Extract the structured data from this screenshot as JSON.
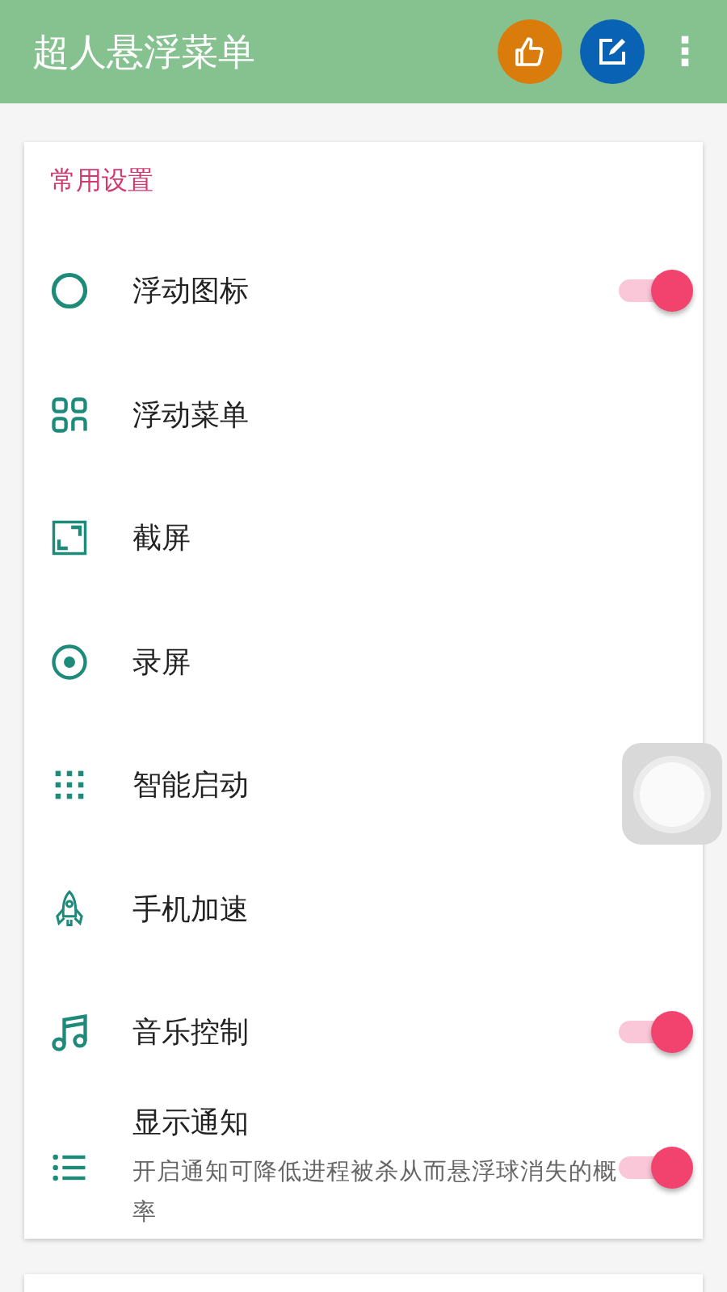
{
  "app_bar": {
    "title": "超人悬浮菜单",
    "more": "⋮"
  },
  "section": {
    "title": "常用设置",
    "items": [
      {
        "label": "浮动图标",
        "kind": "switch",
        "on": true
      },
      {
        "label": "浮动菜单",
        "kind": "link"
      },
      {
        "label": "截屏",
        "kind": "link"
      },
      {
        "label": "录屏",
        "kind": "link"
      },
      {
        "label": "智能启动",
        "kind": "link"
      },
      {
        "label": "手机加速",
        "kind": "link"
      },
      {
        "label": "音乐控制",
        "kind": "switch",
        "on": true
      },
      {
        "label": "显示通知",
        "kind": "switch",
        "on": true,
        "description": "开启通知可降低进程被杀从而悬浮球消失的概率"
      }
    ]
  }
}
